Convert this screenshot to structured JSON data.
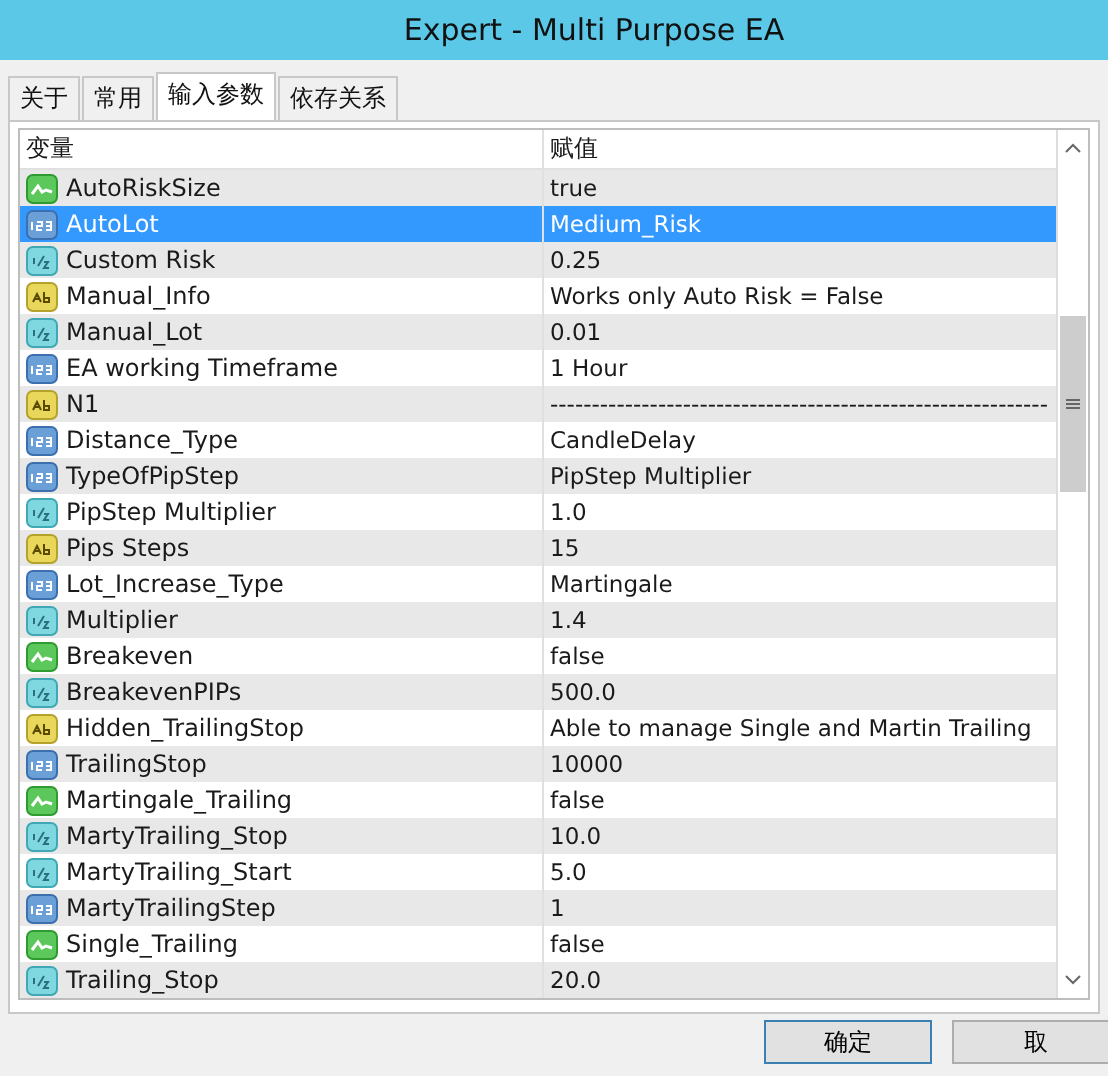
{
  "window": {
    "title": "Expert - Multi Purpose EA"
  },
  "tabs": [
    {
      "label": "关于",
      "selected": false
    },
    {
      "label": "常用",
      "selected": false
    },
    {
      "label": "输入参数",
      "selected": true
    },
    {
      "label": "依存关系",
      "selected": false
    }
  ],
  "table": {
    "columns": [
      "变量",
      "赋值"
    ],
    "rows": [
      {
        "kind": "bool",
        "name": "AutoRiskSize",
        "value": "true",
        "selected": false
      },
      {
        "kind": "enum",
        "name": "AutoLot",
        "value": "Medium_Risk",
        "selected": true
      },
      {
        "kind": "double",
        "name": "Custom Risk",
        "value": "0.25",
        "selected": false
      },
      {
        "kind": "string",
        "name": "Manual_Info",
        "value": "Works only Auto Risk = False",
        "selected": false
      },
      {
        "kind": "double",
        "name": "Manual_Lot",
        "value": "0.01",
        "selected": false
      },
      {
        "kind": "enum",
        "name": "EA working Timeframe",
        "value": "1 Hour",
        "selected": false
      },
      {
        "kind": "string",
        "name": "N1",
        "value": "------------------------------------------------------------",
        "selected": false
      },
      {
        "kind": "enum",
        "name": "Distance_Type",
        "value": "CandleDelay",
        "selected": false
      },
      {
        "kind": "enum",
        "name": "TypeOfPipStep",
        "value": "PipStep Multiplier",
        "selected": false
      },
      {
        "kind": "double",
        "name": "PipStep Multiplier",
        "value": "1.0",
        "selected": false
      },
      {
        "kind": "string",
        "name": "Pips Steps",
        "value": "15",
        "selected": false
      },
      {
        "kind": "enum",
        "name": "Lot_Increase_Type",
        "value": "Martingale",
        "selected": false
      },
      {
        "kind": "double",
        "name": "Multiplier",
        "value": "1.4",
        "selected": false
      },
      {
        "kind": "bool",
        "name": "Breakeven",
        "value": "false",
        "selected": false
      },
      {
        "kind": "double",
        "name": "BreakevenPIPs",
        "value": "500.0",
        "selected": false
      },
      {
        "kind": "string",
        "name": "Hidden_TrailingStop",
        "value": "Able to manage Single and Martin Trailing",
        "selected": false
      },
      {
        "kind": "enum",
        "name": "TrailingStop",
        "value": "10000",
        "selected": false
      },
      {
        "kind": "bool",
        "name": "Martingale_Trailing",
        "value": "false",
        "selected": false
      },
      {
        "kind": "double",
        "name": "MartyTrailing_Stop",
        "value": "10.0",
        "selected": false
      },
      {
        "kind": "double",
        "name": "MartyTrailing_Start",
        "value": "5.0",
        "selected": false
      },
      {
        "kind": "enum",
        "name": "MartyTrailingStep",
        "value": "1",
        "selected": false
      },
      {
        "kind": "bool",
        "name": "Single_Trailing",
        "value": "false",
        "selected": false
      },
      {
        "kind": "double",
        "name": "Trailing_Stop",
        "value": "20.0",
        "selected": false
      }
    ]
  },
  "buttons": [
    "确定",
    "取"
  ]
}
